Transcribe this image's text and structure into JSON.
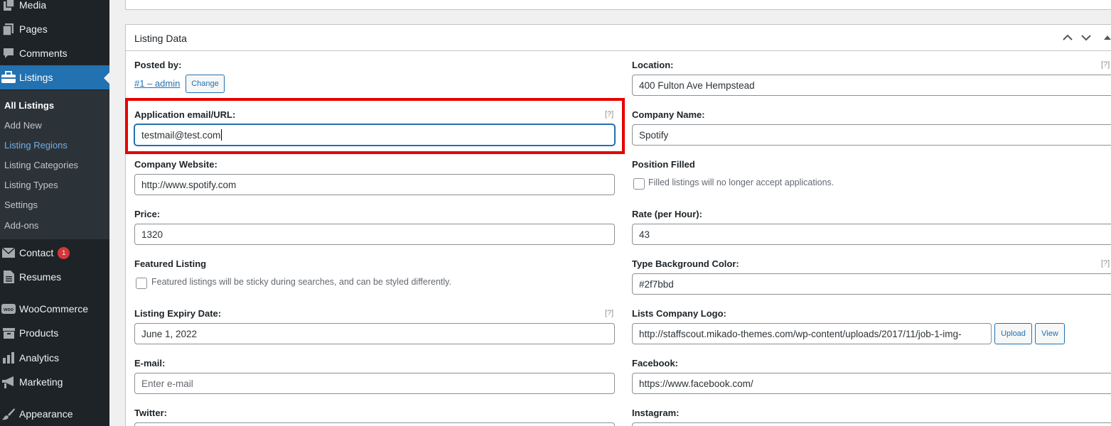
{
  "sidebar": {
    "media": "Media",
    "pages": "Pages",
    "comments": "Comments",
    "listings": "Listings",
    "submenu": [
      "All Listings",
      "Add New",
      "Listing Regions",
      "Listing Categories",
      "Listing Types",
      "Settings",
      "Add-ons"
    ],
    "contact": "Contact",
    "contact_badge": "1",
    "resumes": "Resumes",
    "woocommerce": "WooCommerce",
    "woo_icon_text": "woo",
    "products": "Products",
    "analytics": "Analytics",
    "marketing": "Marketing",
    "appearance": "Appearance"
  },
  "panel": {
    "title": "Listing Data"
  },
  "fields": {
    "posted_by_label": "Posted by:",
    "posted_by_link": "#1 – admin",
    "change_button": "Change",
    "location_label": "Location:",
    "location_value": "400 Fulton Ave Hempstead",
    "app_email_label": "Application email/URL:",
    "app_email_value": "testmail@test.com",
    "company_name_label": "Company Name:",
    "company_name_value": "Spotify",
    "company_website_label": "Company Website:",
    "company_website_value": "http://www.spotify.com",
    "position_filled_label": "Position Filled",
    "position_filled_desc": "Filled listings will no longer accept applications.",
    "price_label": "Price:",
    "price_value": "1320",
    "rate_label": "Rate (per Hour):",
    "rate_value": "43",
    "featured_label": "Featured Listing",
    "featured_desc": "Featured listings will be sticky during searches, and can be styled differently.",
    "type_bg_label": "Type Background Color:",
    "type_bg_value": "#2f7bbd",
    "expiry_label": "Listing Expiry Date:",
    "expiry_value": "June 1, 2022",
    "logo_label": "Lists Company Logo:",
    "logo_value": "http://staffscout.mikado-themes.com/wp-content/uploads/2017/11/job-1-img-",
    "upload_button": "Upload",
    "view_button": "View",
    "email_label": "E-mail:",
    "email_placeholder": "Enter e-mail",
    "facebook_label": "Facebook:",
    "facebook_value": "https://www.facebook.com/",
    "twitter_label": "Twitter:",
    "instagram_label": "Instagram:",
    "help_text": "[?]"
  },
  "colors": {
    "sidebar_bg": "#1d2327",
    "accent": "#2271b1",
    "highlight": "#e60000"
  }
}
